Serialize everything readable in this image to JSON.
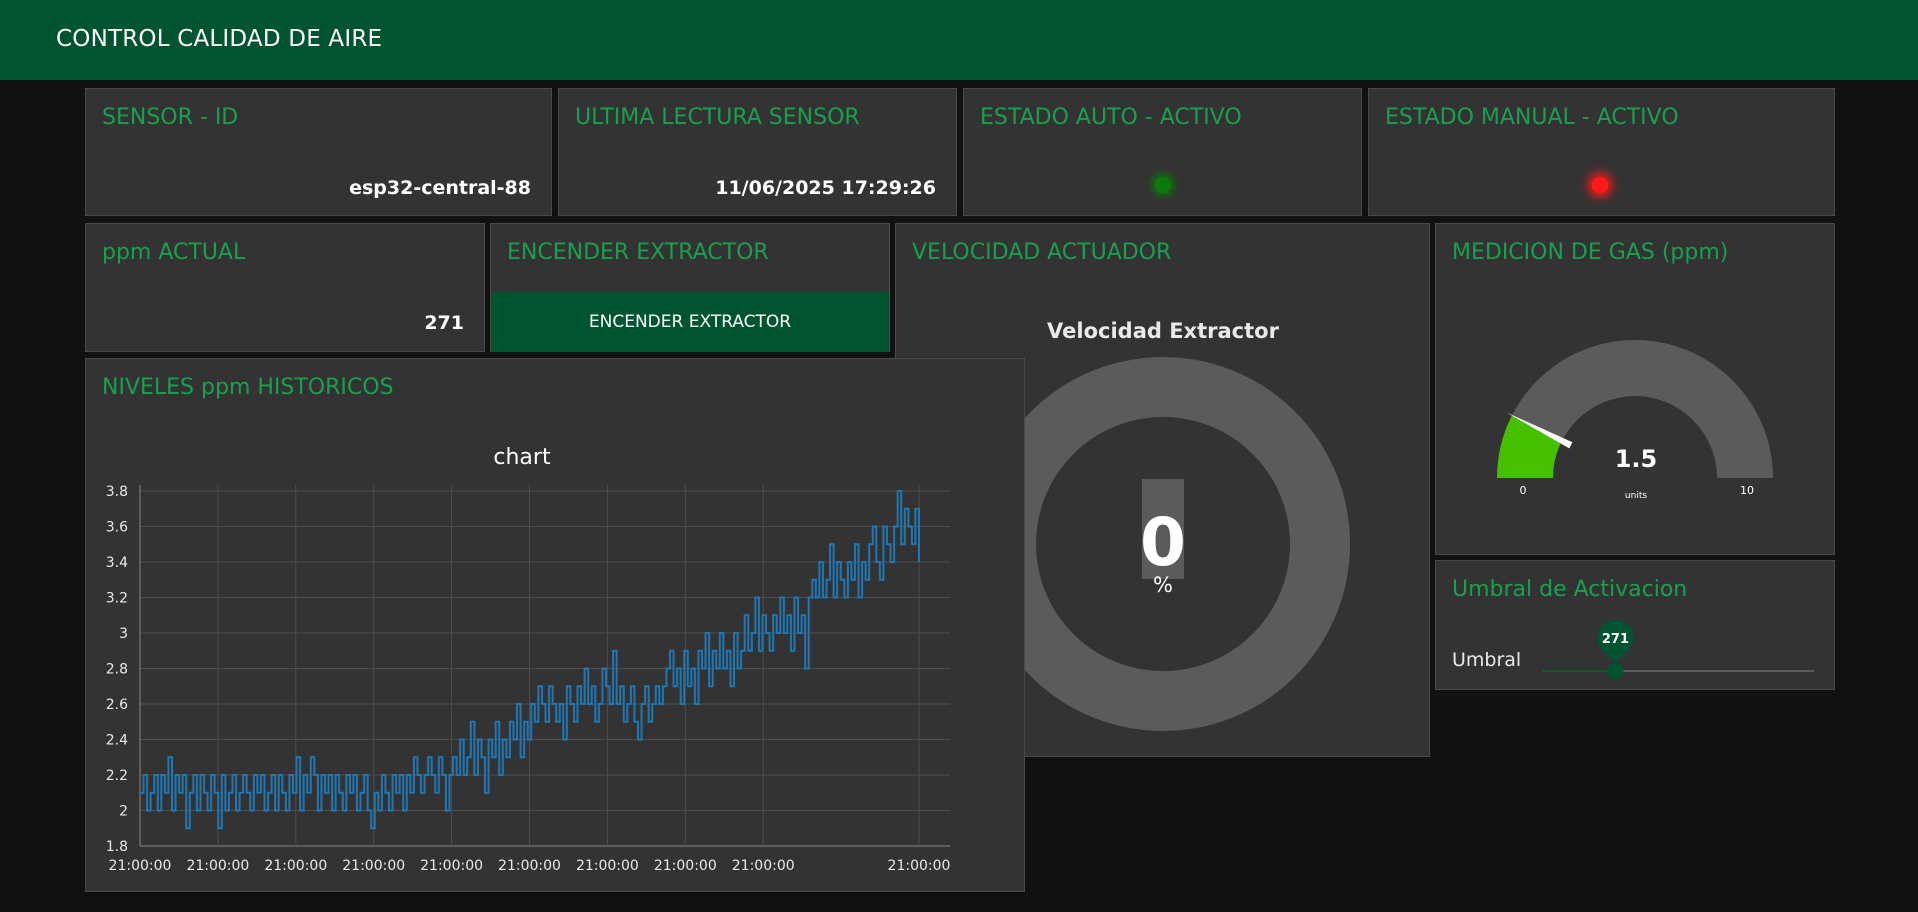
{
  "header": {
    "title": "CONTROL CALIDAD DE AIRE"
  },
  "sensor_id": {
    "title": "SENSOR - ID",
    "value": "esp32-central-88"
  },
  "last_reading": {
    "title": "ULTIMA LECTURA SENSOR",
    "value": "11/06/2025 17:29:26"
  },
  "auto_state": {
    "title": "ESTADO AUTO - ACTIVO",
    "led_color": "#0a7a0a"
  },
  "manual_state": {
    "title": "ESTADO MANUAL - ACTIVO",
    "led_color": "#ff1a1a"
  },
  "ppm_actual": {
    "title": "ppm ACTUAL",
    "value": "271"
  },
  "extractor": {
    "title": "ENCENDER EXTRACTOR",
    "button_label": "ENCENDER EXTRACTOR"
  },
  "speed": {
    "title": "VELOCIDAD ACTUADOR",
    "donut_title": "Velocidad Extractor",
    "value": 0,
    "value_label": "0",
    "unit": "%"
  },
  "gas_gauge": {
    "title": "MEDICION DE GAS (ppm)",
    "value": 1.5,
    "value_label": "1.5",
    "min": 0,
    "max": 10,
    "min_label": "0",
    "max_label": "10",
    "units": "units",
    "fill_color": "#44c000"
  },
  "threshold": {
    "title": "Umbral de Activacion",
    "label": "Umbral",
    "value": 271,
    "value_label": "271",
    "position_fraction": 0.27
  },
  "history": {
    "title": "NIVELES ppm HISTORICOS"
  },
  "colors": {
    "header_bg": "#005530",
    "accent_text": "#19a04e",
    "card_bg": "#333333",
    "page_bg": "#111111",
    "series": "#1f77b4"
  },
  "chart_data": {
    "type": "line",
    "title": "chart",
    "xlabel": "",
    "ylabel": "",
    "ylim": [
      1.8,
      3.8
    ],
    "y_ticks": [
      1.8,
      2,
      2.2,
      2.4,
      2.6,
      2.8,
      3,
      3.2,
      3.4,
      3.6,
      3.8
    ],
    "y_tick_labels": [
      "1.8",
      "2",
      "2.2",
      "2.4",
      "2.6",
      "2.8",
      "3",
      "3.2",
      "3.4",
      "3.6",
      "3.8"
    ],
    "x_tick_labels": [
      "21:00:00",
      "21:00:00",
      "21:00:00",
      "21:00:00",
      "21:00:00",
      "21:00:00",
      "21:00:00",
      "21:00:00",
      "21:00:00",
      "21:00:00"
    ],
    "x_tick_positions": [
      0,
      1,
      2,
      3,
      4,
      5,
      6,
      7,
      8,
      10
    ],
    "grid": true,
    "series": [
      {
        "values": [
          2.1,
          2.2,
          2.0,
          2.1,
          2.2,
          2.0,
          2.2,
          2.1,
          2.3,
          2.0,
          2.2,
          2.1,
          2.2,
          1.9,
          2.1,
          2.2,
          2.0,
          2.2,
          2.1,
          2.0,
          2.2,
          2.1,
          1.9,
          2.2,
          2.0,
          2.1,
          2.2,
          2.0,
          2.1,
          2.2,
          2.1,
          2.0,
          2.2,
          2.1,
          2.2,
          2.0,
          2.1,
          2.2,
          2.0,
          2.2,
          2.1,
          2.0,
          2.2,
          2.1,
          2.3,
          2.0,
          2.2,
          2.1,
          2.3,
          2.2,
          2.0,
          2.2,
          2.1,
          2.2,
          2.0,
          2.2,
          2.1,
          2.0,
          2.2,
          2.1,
          2.2,
          2.0,
          2.1,
          2.2,
          2.0,
          1.9,
          2.1,
          2.0,
          2.2,
          2.1,
          2.0,
          2.2,
          2.1,
          2.2,
          2.0,
          2.2,
          2.1,
          2.3,
          2.2,
          2.1,
          2.2,
          2.3,
          2.2,
          2.1,
          2.3,
          2.2,
          2.0,
          2.2,
          2.3,
          2.2,
          2.4,
          2.2,
          2.3,
          2.5,
          2.2,
          2.4,
          2.3,
          2.1,
          2.4,
          2.3,
          2.5,
          2.2,
          2.4,
          2.3,
          2.5,
          2.4,
          2.6,
          2.3,
          2.5,
          2.4,
          2.6,
          2.5,
          2.7,
          2.6,
          2.5,
          2.7,
          2.6,
          2.5,
          2.6,
          2.4,
          2.7,
          2.6,
          2.5,
          2.7,
          2.6,
          2.8,
          2.6,
          2.7,
          2.5,
          2.6,
          2.8,
          2.7,
          2.6,
          2.9,
          2.6,
          2.7,
          2.5,
          2.6,
          2.7,
          2.5,
          2.4,
          2.6,
          2.7,
          2.5,
          2.6,
          2.7,
          2.6,
          2.7,
          2.8,
          2.9,
          2.7,
          2.8,
          2.6,
          2.9,
          2.7,
          2.8,
          2.6,
          2.9,
          2.8,
          3.0,
          2.7,
          2.9,
          2.8,
          3.0,
          2.8,
          2.9,
          2.7,
          3.0,
          2.8,
          2.9,
          3.1,
          2.9,
          3.0,
          3.2,
          2.9,
          3.1,
          3.0,
          2.9,
          3.1,
          3.0,
          3.2,
          3.0,
          3.1,
          2.9,
          3.2,
          3.0,
          3.1,
          2.8,
          3.2,
          3.3,
          3.2,
          3.4,
          3.2,
          3.3,
          3.5,
          3.2,
          3.4,
          3.3,
          3.2,
          3.4,
          3.3,
          3.5,
          3.2,
          3.4,
          3.3,
          3.5,
          3.6,
          3.4,
          3.3,
          3.6,
          3.5,
          3.4,
          3.6,
          3.8,
          3.5,
          3.7,
          3.6,
          3.5,
          3.7,
          3.4
        ]
      }
    ]
  }
}
